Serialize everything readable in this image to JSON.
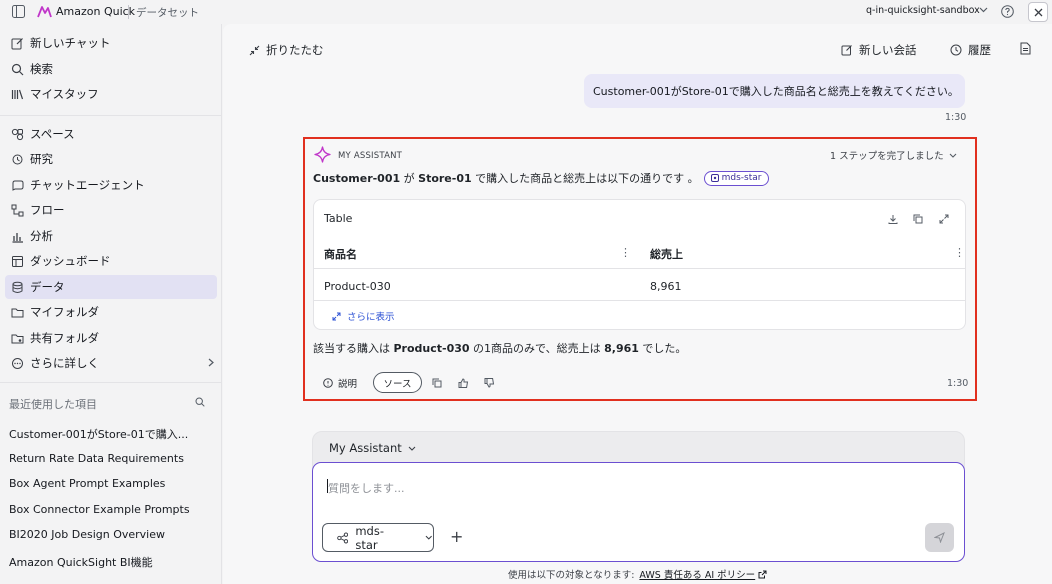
{
  "topbar": {
    "app_title": "Amazon Quick",
    "breadcrumb": "データセット",
    "account": "q-in-quicksight-sandbox"
  },
  "sidebar": {
    "top_items": [
      {
        "label": "新しいチャット",
        "icon": "edit-icon"
      },
      {
        "label": "検索",
        "icon": "search-icon"
      },
      {
        "label": "マイスタッフ",
        "icon": "library-icon"
      }
    ],
    "items": [
      {
        "label": "スペース",
        "icon": "spaces-icon"
      },
      {
        "label": "研究",
        "icon": "research-icon"
      },
      {
        "label": "チャットエージェント",
        "icon": "chat-agent-icon"
      },
      {
        "label": "フロー",
        "icon": "flow-icon"
      },
      {
        "label": "分析",
        "icon": "analysis-icon"
      },
      {
        "label": "ダッシュボード",
        "icon": "dashboard-icon"
      },
      {
        "label": "データ",
        "icon": "database-icon",
        "active": true
      },
      {
        "label": "マイフォルダ",
        "icon": "folder-icon"
      },
      {
        "label": "共有フォルダ",
        "icon": "shared-folder-icon"
      },
      {
        "label": "さらに詳しく",
        "icon": "more-icon"
      }
    ],
    "recent_heading": "最近使用した項目",
    "recent": [
      "Customer-001がStore-01で購入...",
      "Return Rate Data Requirements",
      "Box Agent Prompt Examples",
      "Box Connector Example Prompts",
      "BI2020 Job Design Overview",
      "Amazon QuickSight BI機能"
    ]
  },
  "toolbar": {
    "collapse": "折りたたむ",
    "new_chat": "新しい会話",
    "history": "履歴"
  },
  "user_message": {
    "text": "Customer-001がStore-01で購入した商品名と総売上を教えてください。",
    "time": "1:30"
  },
  "assistant": {
    "name": "MY ASSISTANT",
    "steps": "1 ステップを完了しました",
    "intro_parts": [
      "Customer-001",
      " が ",
      "Store-01",
      " で購入した商品と総売上は以下の通りです 。"
    ],
    "chip": "mds-star",
    "table": {
      "title": "Table",
      "columns": [
        "商品名",
        "総売上"
      ],
      "rows": [
        [
          "Product-030",
          "8,961"
        ]
      ],
      "show_more": "さらに表示"
    },
    "summary_parts": [
      "該当する購入は ",
      "Product-030",
      " の1商品のみで、総売上は ",
      "8,961",
      " でした。"
    ],
    "explain": "説明",
    "source": "ソース",
    "time": "1:30"
  },
  "composer": {
    "mode": "My Assistant",
    "placeholder": "質問をします...",
    "source": "mds-star"
  },
  "footer": {
    "text": "使用は以下の対象となります:",
    "link": "AWS 責任ある AI ポリシー"
  },
  "colors": {
    "accent": "#6b4fd1",
    "highlight_border": "#e1301f",
    "active_nav": "#e2e1f3",
    "user_bubble": "#e9e8f8"
  }
}
